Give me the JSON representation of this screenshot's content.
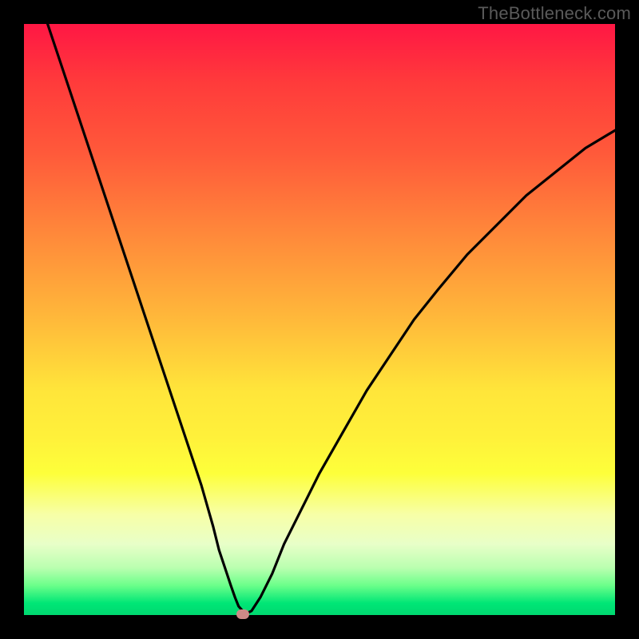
{
  "watermark": "TheBottleneck.com",
  "colors": {
    "page_bg": "#000000",
    "gradient_top": "#ff1744",
    "gradient_bottom": "#00d870",
    "curve": "#000000",
    "marker": "#cd8a87",
    "watermark_text": "#5a5a5a"
  },
  "chart_data": {
    "type": "line",
    "title": "",
    "xlabel": "",
    "ylabel": "",
    "xlim": [
      0,
      100
    ],
    "ylim": [
      0,
      100
    ],
    "grid": false,
    "legend": null,
    "annotations": [],
    "series": [
      {
        "name": "curve",
        "x": [
          4,
          6,
          8,
          10,
          12,
          14,
          16,
          18,
          20,
          22,
          24,
          26,
          28,
          30,
          32,
          33,
          34,
          35,
          35.7,
          36.3,
          37,
          37.7,
          38.5,
          40,
          42,
          44,
          47,
          50,
          54,
          58,
          62,
          66,
          70,
          75,
          80,
          85,
          90,
          95,
          100
        ],
        "y": [
          100,
          94,
          88,
          82,
          76,
          70,
          64,
          58,
          52,
          46,
          40,
          34,
          28,
          22,
          15,
          11,
          8,
          5,
          3,
          1.5,
          0.7,
          0.3,
          0.7,
          3,
          7,
          12,
          18,
          24,
          31,
          38,
          44,
          50,
          55,
          61,
          66,
          71,
          75,
          79,
          82
        ]
      }
    ],
    "marker": {
      "x": 37,
      "y": 0.2
    }
  }
}
